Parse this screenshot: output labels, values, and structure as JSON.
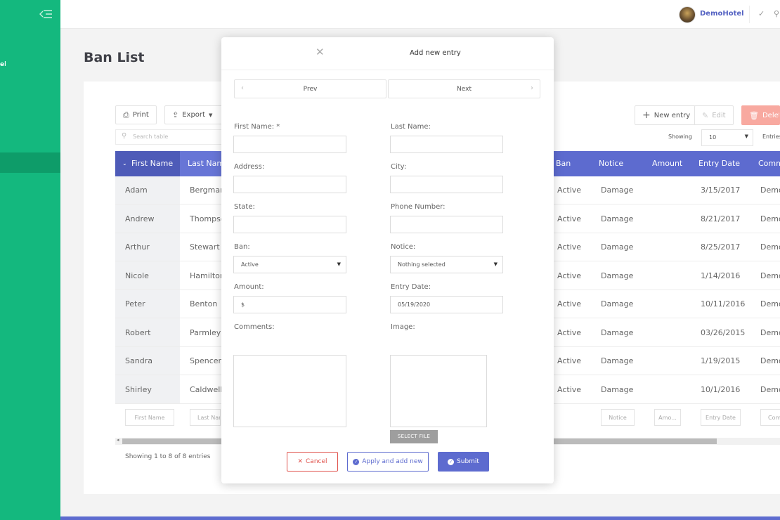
{
  "colors": {
    "sidebar": "#14b87e",
    "accent": "#5d6bcf",
    "danger": "#e0524c"
  },
  "sidebar": {
    "clipped_label": "el",
    "toggle_icon": "menu-collapse-icon"
  },
  "topbar": {
    "hotel_name": "DemoHotel"
  },
  "page": {
    "title": "Ban List"
  },
  "toolbar": {
    "print": "Print",
    "export": "Export",
    "search_placeholder": "Search table",
    "new_entry": "New entry",
    "edit": "Edit",
    "delete": "Delete",
    "showing": "Showing",
    "page_size": "10",
    "entries": "Entries"
  },
  "table": {
    "columns": {
      "first_name": "First Name",
      "last_name": "Last Name",
      "ban": "Ban",
      "notice": "Notice",
      "amount": "Amount",
      "entry_date": "Entry Date",
      "comments": "Comments"
    },
    "rows": [
      {
        "first": "Adam",
        "last": "Bergman",
        "ban": "Active",
        "notice": "Damage",
        "date": "3/15/2017",
        "comments": "Demo"
      },
      {
        "first": "Andrew",
        "last": "Thompson",
        "ban": "Active",
        "notice": "Damage",
        "date": "8/21/2017",
        "comments": "Demo"
      },
      {
        "first": "Arthur",
        "last": "Stewart",
        "ban": "Active",
        "notice": "Damage",
        "date": "8/25/2017",
        "comments": "Demo"
      },
      {
        "first": "Nicole",
        "last": "Hamilton",
        "ban": "Active",
        "notice": "Damage",
        "date": "1/14/2016",
        "comments": "Demo"
      },
      {
        "first": "Peter",
        "last": "Benton",
        "ban": "Active",
        "notice": "Damage",
        "date": "10/11/2016",
        "comments": "Demo"
      },
      {
        "first": "Robert",
        "last": "Parmley",
        "ban": "Active",
        "notice": "Damage",
        "date": "03/26/2015",
        "comments": "Demo"
      },
      {
        "first": "Sandra",
        "last": "Spencer",
        "ban": "Active",
        "notice": "Damage",
        "date": "1/19/2015",
        "comments": "Demo"
      },
      {
        "first": "Shirley",
        "last": "Caldwell",
        "ban": "Active",
        "notice": "Damage",
        "date": "10/1/2016",
        "comments": "Demo"
      }
    ],
    "filters": {
      "first_name": "First Name",
      "last_name": "Last Name",
      "notice": "Notice",
      "amount": "Amo...",
      "entry_date": "Entry Date",
      "comments": "Comments"
    },
    "footer": "Showing 1 to 8 of 8 entries"
  },
  "modal": {
    "title": "Add new entry",
    "prev": "Prev",
    "next": "Next",
    "labels": {
      "first_name": "First Name: *",
      "last_name": "Last Name:",
      "address": "Address:",
      "city": "City:",
      "state": "State:",
      "phone": "Phone Number:",
      "ban": "Ban:",
      "notice": "Notice:",
      "amount": "Amount:",
      "entry_date": "Entry Date:",
      "comments": "Comments:",
      "image": "Image:"
    },
    "values": {
      "ban": "Active",
      "notice": "Nothing selected",
      "amount": "$",
      "entry_date": "05/19/2020"
    },
    "select_file": "SELECT FILE",
    "buttons": {
      "cancel": "Cancel",
      "apply": "Apply and add new",
      "submit": "Submit"
    }
  }
}
